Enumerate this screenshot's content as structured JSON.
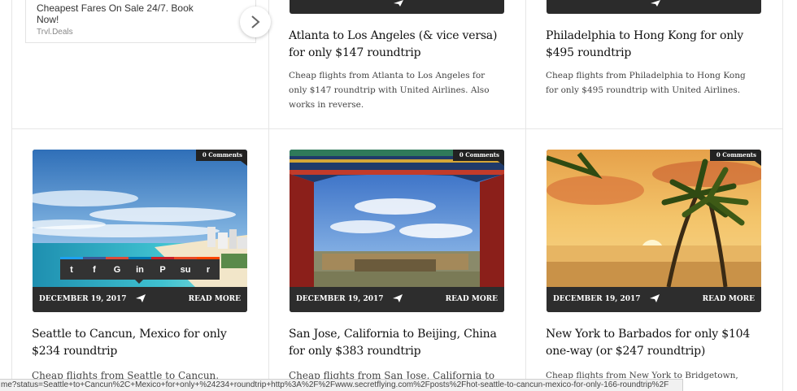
{
  "ad": {
    "text": "Cheapest Fares On Sale 24/7. Book Now!",
    "source": "Trvl.Deals"
  },
  "top_posts": [
    {
      "title": "Atlanta to Los Angeles (& vice versa) for only $147 roundtrip",
      "excerpt": "Cheap flights from Atlanta to Los Angeles for only $147 roundtrip with United Airlines. Also works in reverse."
    },
    {
      "title": "Philadelphia to Hong Kong for only $495 roundtrip",
      "excerpt": "Cheap flights from Philadelphia to Hong Kong for only $495 roundtrip with United Airlines."
    }
  ],
  "posts": [
    {
      "comments": "0 Comments",
      "date": "DECEMBER 19, 2017",
      "read_more": "READ MORE",
      "title": "Seattle to Cancun, Mexico for only $234 roundtrip",
      "excerpt": "Cheap flights from Seattle to Cancun, Mexico"
    },
    {
      "comments": "0 Comments",
      "date": "DECEMBER 19, 2017",
      "read_more": "READ MORE",
      "title": "San Jose, California to Beijing, China for only $383 roundtrip",
      "excerpt": "Cheap flights from San Jose, California to"
    },
    {
      "comments": "0 Comments",
      "date": "DECEMBER 19, 2017",
      "read_more": "READ MORE",
      "title": "New York to Barbados for only $104 one-way (or $247 roundtrip)",
      "excerpt": "Cheap flights from New York to Bridgetown, ...ith JetBlue. Or fly"
    }
  ],
  "share": {
    "icons": [
      "twitter-icon",
      "facebook-icon",
      "google-plus-icon",
      "linkedin-icon",
      "pinterest-icon",
      "stumbleupon-icon",
      "reddit-icon"
    ],
    "labels": [
      "t",
      "f",
      "G",
      "in",
      "P",
      "su",
      "r"
    ],
    "colors": [
      "#1da1f2",
      "#3b5998",
      "#dd4b39",
      "#0077b5",
      "#cb2027",
      "#eb4924",
      "#ff4500"
    ]
  },
  "status_url": "me?status=Seattle+to+Cancun%2C+Mexico+for+only+%24234+roundtrip+http%3A%2F%2Fwww.secretflying.com%2Fposts%2Fhot-seattle-to-cancun-mexico-for-only-166-roundtrip%2F",
  "colors": {
    "bar": "#2b2b2b",
    "text": "#111111"
  }
}
